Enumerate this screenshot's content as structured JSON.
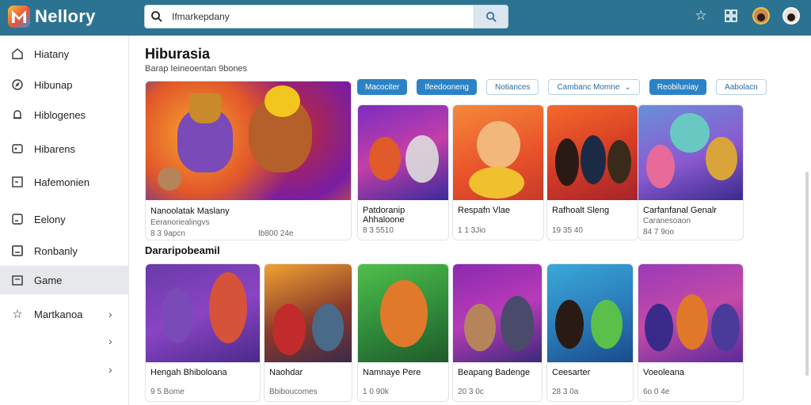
{
  "app": {
    "name": "Nellory"
  },
  "search": {
    "value": "Ifmarkepdany",
    "placeholder": ""
  },
  "colors": {
    "topbar": "#2c7391",
    "accent": "#2b83c6"
  },
  "top_icons": [
    "star-icon",
    "grid-icon",
    "avatar",
    "avatar"
  ],
  "sidebar": {
    "items": [
      {
        "label": "Hiatany",
        "icon": "home-icon"
      },
      {
        "label": "Hibunap",
        "icon": "compass-icon"
      },
      {
        "label": "Hiblogenes",
        "icon": "bell-icon"
      },
      {
        "label": "Hibarens",
        "icon": "gamepad-icon"
      },
      {
        "label": "Hafemonien",
        "icon": "calendar-icon"
      },
      {
        "label": "Eelony",
        "icon": "chart-icon"
      },
      {
        "label": "Ronbanly",
        "icon": "bookmark-icon"
      },
      {
        "label": "Game",
        "icon": "folder-icon",
        "active": true
      },
      {
        "label": "Martkanoa",
        "icon": "star-icon"
      }
    ],
    "chevron": "›"
  },
  "main": {
    "title": "Hiburasia",
    "subtitle": "Barap Ieineoentan 9bones",
    "chips": [
      {
        "label": "Macociter",
        "style": "blue"
      },
      {
        "label": "Ifeedooneng",
        "style": "blue"
      },
      {
        "label": "Notiances",
        "style": "light"
      },
      {
        "label": "Cambanc Momne",
        "style": "light",
        "dropdown": true
      },
      {
        "label": "Reobiluniay",
        "style": "blue"
      },
      {
        "label": "Aabolacn",
        "style": "light"
      }
    ],
    "featured": {
      "title": "Nanoolatak Maslany",
      "meta": "Eeranoriealingvs",
      "meta2": "8 3 9apcn",
      "meta3": "Ib800 24e"
    },
    "row1": [
      {
        "title": "Patdoranip Ahhaloone",
        "meta": "8 3 5510"
      },
      {
        "title": "Respafn Vlae",
        "meta": "1 1 3Jio"
      },
      {
        "title": "Rafhoalt Sleng",
        "meta": "19 35 40"
      },
      {
        "title": "Carfanfanal Genalr",
        "meta": "Caranesoaon",
        "meta2": "84 7 9oo"
      }
    ],
    "section2_title": "Dararipobeamil",
    "row2": [
      {
        "title": "Hengah Bhiboloana",
        "meta": "9 5 Bome"
      },
      {
        "title": "Naohdar",
        "meta": "Bbiboucomes"
      },
      {
        "title": "Namnaye Pere",
        "meta": "1 0 90k"
      },
      {
        "title": "Beapang Badenge",
        "meta": "20 3 0c"
      },
      {
        "title": "Ceesarter",
        "meta": "28 3 0a"
      },
      {
        "title": "Voeoleana",
        "meta": "6o 0 4e"
      }
    ]
  }
}
